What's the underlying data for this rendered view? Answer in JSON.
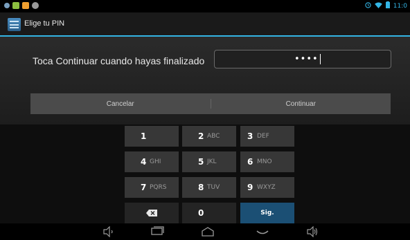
{
  "status_bar": {
    "time": "11:0",
    "left_icons": [
      "debug-icon",
      "android-icon",
      "notification-icon",
      "chat-icon"
    ],
    "right_icons": [
      "alarm-icon",
      "wifi-icon",
      "battery-icon"
    ]
  },
  "action_bar": {
    "title": "Elige tu PIN",
    "icon": "settings-icon"
  },
  "main": {
    "prompt": "Toca Continuar cuando hayas finalizado",
    "pin_field": {
      "masked_value": "••••"
    }
  },
  "buttons": {
    "cancel": "Cancelar",
    "continue": "Continuar"
  },
  "keypad": {
    "rows": [
      [
        {
          "main": "1",
          "sub": ""
        },
        {
          "main": "2",
          "sub": "ABC"
        },
        {
          "main": "3",
          "sub": "DEF"
        }
      ],
      [
        {
          "main": "4",
          "sub": "GHI"
        },
        {
          "main": "5",
          "sub": "JKL"
        },
        {
          "main": "6",
          "sub": "MNO"
        }
      ],
      [
        {
          "main": "7",
          "sub": "PQRS"
        },
        {
          "main": "8",
          "sub": "TUV"
        },
        {
          "main": "9",
          "sub": "WXYZ"
        }
      ]
    ],
    "zero": "0",
    "next": "Sig.",
    "delete_icon": "backspace-icon"
  },
  "nav_bar": {
    "icons": [
      "volume-down-icon",
      "back-icon",
      "home-icon",
      "recent-apps-icon",
      "volume-up-icon"
    ]
  },
  "colors": {
    "accent": "#33b5e5",
    "action_key": "#1b4f74"
  }
}
